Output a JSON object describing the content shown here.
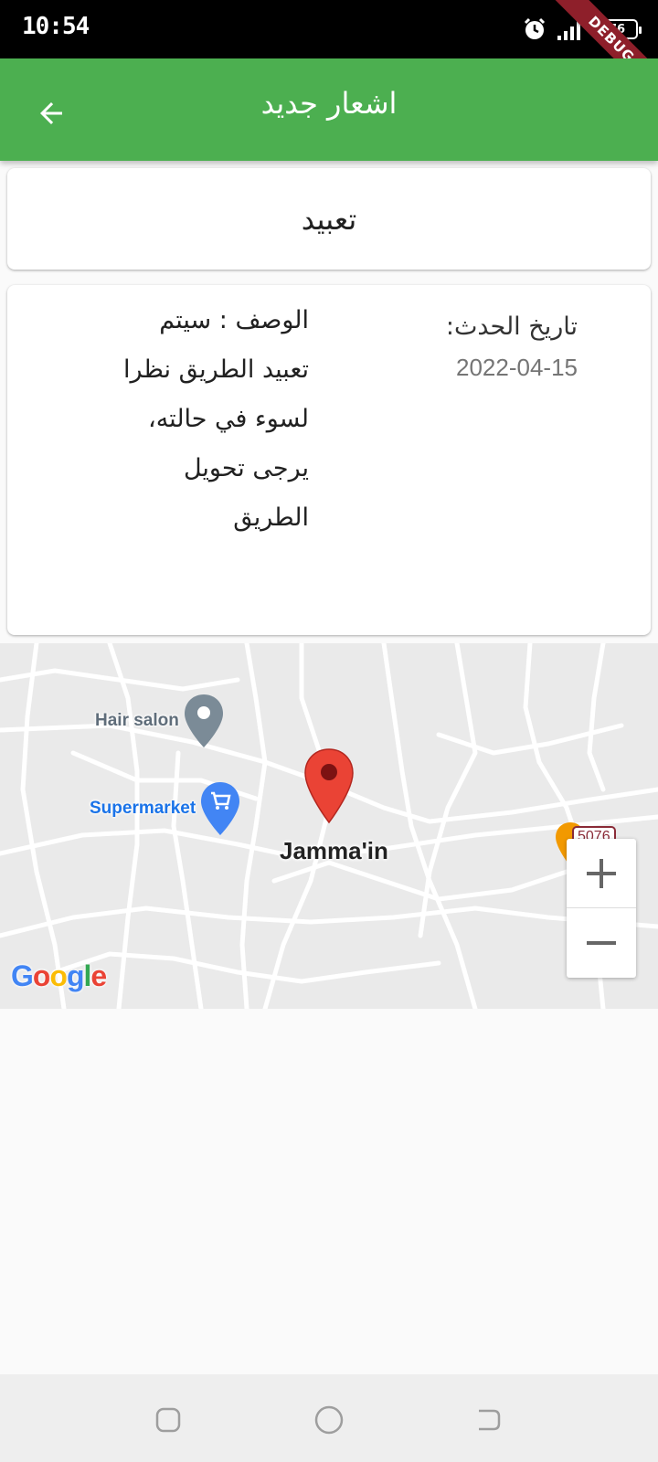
{
  "status_bar": {
    "time": "10:54",
    "battery": "76",
    "debug_banner": "DEBUG"
  },
  "app_bar": {
    "title": "اشعار جديد",
    "back_icon": "arrow-back-icon",
    "color": "#4caf50"
  },
  "notification": {
    "title": "تعبيد",
    "date_label": "تاريخ الحدث:",
    "date_value": "2022-04-15",
    "description": "الوصف : سيتم تعبيد الطريق نظرا لسوء في حالته، يرجى تحويل الطريق"
  },
  "map": {
    "place_name": "Jamma'in",
    "poi": {
      "hair_salon": "Hair salon",
      "supermarket": "Supermarket"
    },
    "route_number": "5076",
    "zoom_in_icon": "plus-icon",
    "zoom_out_icon": "minus-icon",
    "marker_color": "#ea4335"
  },
  "nav_bar": {
    "icons": [
      "recent-apps-icon",
      "home-icon",
      "back-icon"
    ]
  }
}
